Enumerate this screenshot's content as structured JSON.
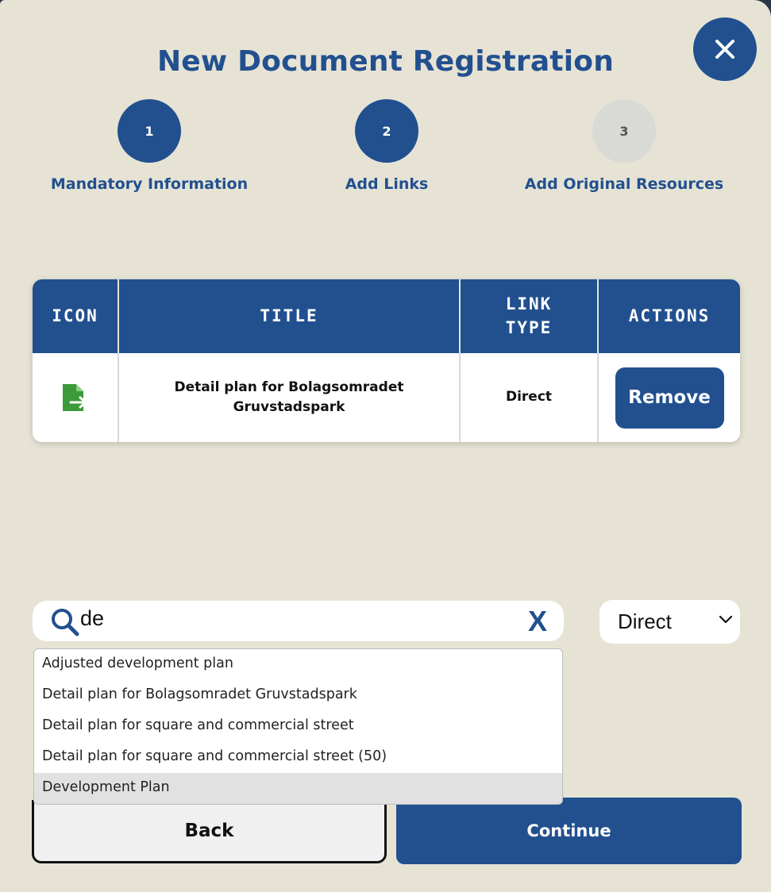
{
  "dialog": {
    "title": "New Document Registration",
    "close_icon": "close-icon"
  },
  "steps": [
    {
      "number": "1",
      "label": "Mandatory Information",
      "state": "completed"
    },
    {
      "number": "2",
      "label": "Add Links",
      "state": "current"
    },
    {
      "number": "3",
      "label": "Add Original Resources",
      "state": "pending"
    }
  ],
  "links_table": {
    "headers": {
      "icon": "ICON",
      "title": "TITLE",
      "link_type_line1": "LINK",
      "link_type_line2": "TYPE",
      "actions": "ACTIONS"
    },
    "rows": [
      {
        "icon": "document-link-icon",
        "title_line1": "Detail plan for Bolagsomradet",
        "title_line2": "Gruvstadspark",
        "link_type": "Direct",
        "action_label": "Remove"
      }
    ]
  },
  "search": {
    "icon": "search-icon",
    "value": "de",
    "clear_label": "X"
  },
  "link_type_select": {
    "value": "Direct"
  },
  "suggestions": [
    "Adjusted development plan",
    "Detail plan for Bolagsomradet Gruvstadspark",
    "Detail plan for square and commercial street",
    "Detail plan for square and commercial street (50)",
    "Development Plan"
  ],
  "footer": {
    "back_label": "Back",
    "continue_label": "Continue"
  },
  "colors": {
    "primary": "#22508f",
    "background": "#e6e3d5",
    "icon_green": "#3c9a3a",
    "inactive_step": "#d9d9d6"
  }
}
